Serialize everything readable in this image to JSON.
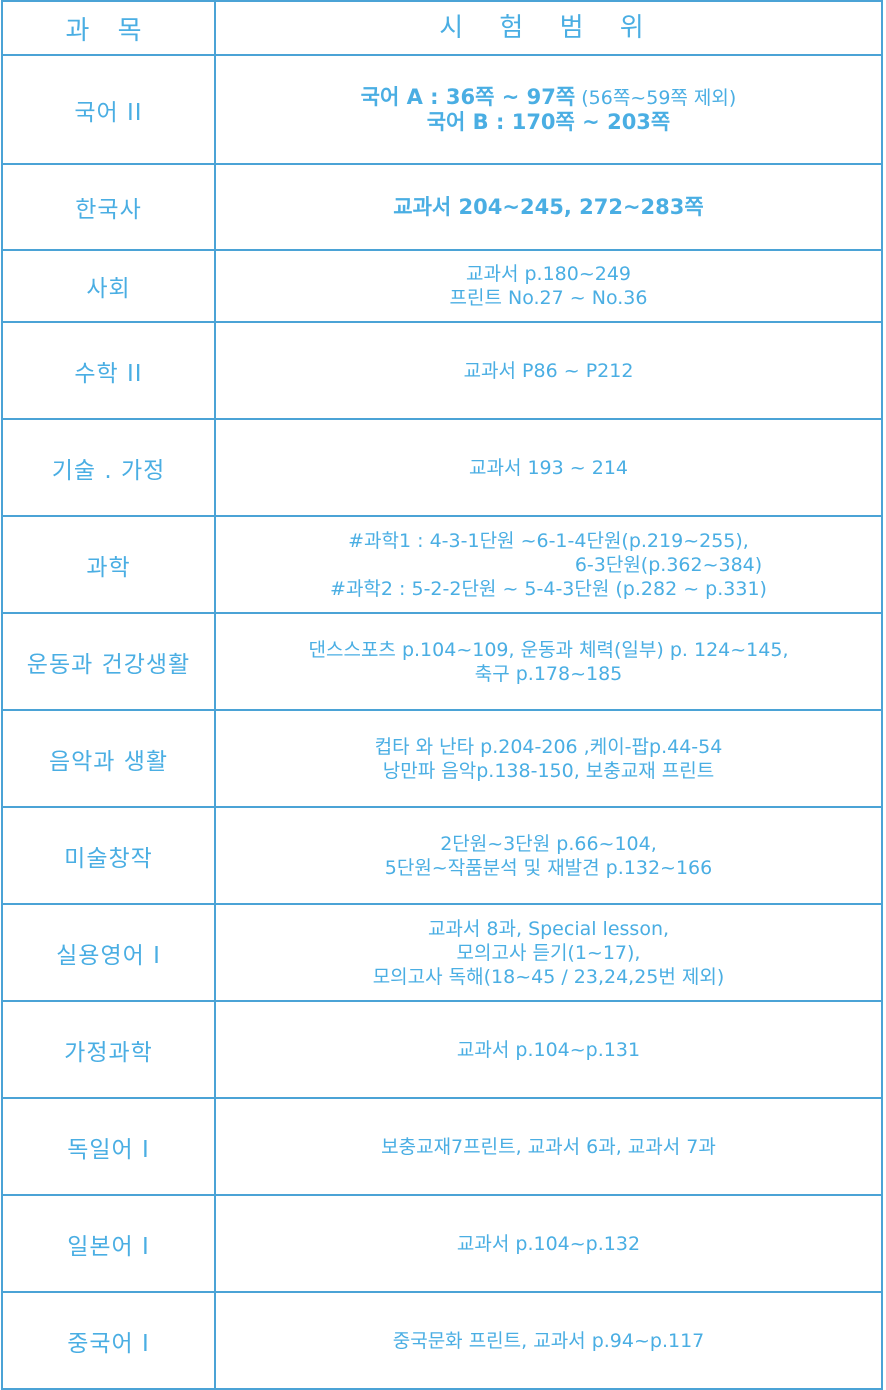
{
  "header": {
    "subject": "과 목",
    "range": "시 험 범 위"
  },
  "rows": [
    {
      "subject": "국어 II",
      "lines": [
        {
          "bold": "국어 A : 36쪽 ~ 97쪽",
          "normal": " (56쪽~59쪽 제외)"
        },
        {
          "bold": "국어 B : 170쪽 ~ 203쪽",
          "normal": ""
        }
      ]
    },
    {
      "subject": "한국사",
      "lines": [
        {
          "bold": "교과서 204~245, 272~283쪽",
          "normal": ""
        }
      ]
    },
    {
      "subject": "사회",
      "lines": [
        {
          "bold": "",
          "normal": "교과서 p.180~249"
        },
        {
          "bold": "",
          "normal": "프린트 No.27 ~ No.36"
        }
      ]
    },
    {
      "subject": "수학 II",
      "lines": [
        {
          "bold": "",
          "normal": "교과서 P86 ~ P212"
        }
      ]
    },
    {
      "subject": "기술 . 가정",
      "lines": [
        {
          "bold": "",
          "normal": "교과서 193 ~ 214"
        }
      ]
    },
    {
      "subject": "과학",
      "lines": [
        {
          "bold": "",
          "normal": "#과학1 : 4-3-1단원 ~6-1-4단원(p.219~255),"
        },
        {
          "bold": "",
          "normal": "6-3단원(p.362~384)"
        },
        {
          "bold": "",
          "normal": "#과학2 : 5-2-2단원 ~ 5-4-3단원 (p.282 ~ p.331)"
        }
      ]
    },
    {
      "subject": "운동과 건강생활",
      "lines": [
        {
          "bold": "",
          "normal": "댄스스포츠 p.104~109, 운동과 체력(일부) p. 124~145,"
        },
        {
          "bold": "",
          "normal": "축구 p.178~185"
        }
      ]
    },
    {
      "subject": "음악과 생활",
      "lines": [
        {
          "bold": "",
          "normal": "컵타 와 난타 p.204-206 ,케이-팝p.44-54"
        },
        {
          "bold": "",
          "normal": "낭만파 음악p.138-150, 보충교재 프린트"
        }
      ]
    },
    {
      "subject": "미술창작",
      "lines": [
        {
          "bold": "",
          "normal": "2단원~3단원 p.66~104,"
        },
        {
          "bold": "",
          "normal": "5단원~작품분석 및 재발견 p.132~166"
        }
      ]
    },
    {
      "subject": "실용영어 I",
      "lines": [
        {
          "bold": "",
          "normal": "교과서 8과, Special lesson,"
        },
        {
          "bold": "",
          "normal": "모의고사 듣기(1~17),"
        },
        {
          "bold": "",
          "normal": "모의고사 독해(18~45 / 23,24,25번 제외)"
        }
      ]
    },
    {
      "subject": "가정과학",
      "lines": [
        {
          "bold": "",
          "normal": "교과서 p.104~p.131"
        }
      ]
    },
    {
      "subject": "독일어 I",
      "lines": [
        {
          "bold": "",
          "normal": "보충교재7프린트, 교과서 6과, 교과서 7과"
        }
      ]
    },
    {
      "subject": "일본어 I",
      "lines": [
        {
          "bold": "",
          "normal": "교과서 p.104~p.132"
        }
      ]
    },
    {
      "subject": "중국어 I",
      "lines": [
        {
          "bold": "",
          "normal": "중국문화 프린트, 교과서 p.94~p.117"
        }
      ]
    }
  ]
}
